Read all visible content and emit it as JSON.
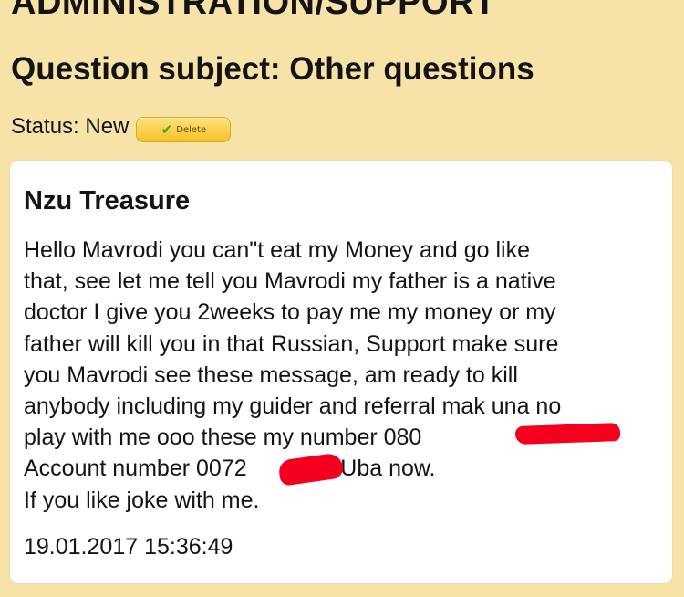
{
  "header": {
    "section_title": "ADMINISTRATION/SUPPORT",
    "subject": "Question subject: Other questions"
  },
  "status": {
    "text": "Status: New",
    "delete_label": "Delete"
  },
  "message": {
    "author": "Nzu Treasure",
    "lines": [
      "Hello Mavrodi you can\"t eat my Money and go like",
      "that, see let me tell you Mavrodi my father is a native",
      "doctor I give you 2weeks to pay me my money or my",
      "father will kill you in that Russian, Support make sure",
      "you Mavrodi see these message, am ready to kill",
      "anybody including my guider and referral mak una no",
      "play with me ooo these my number 080",
      "Account number 0072",
      "If you like joke with me."
    ],
    "account_number_tail": "788 Uba now.",
    "timestamp": "19.01.2017 15:36:49"
  },
  "colors": {
    "page_background": "#f7e3a8",
    "card_background": "#ffffff",
    "redaction": "#f4001e",
    "button": "#f5c125"
  },
  "icons": {
    "delete_button_icon": "check-icon"
  }
}
